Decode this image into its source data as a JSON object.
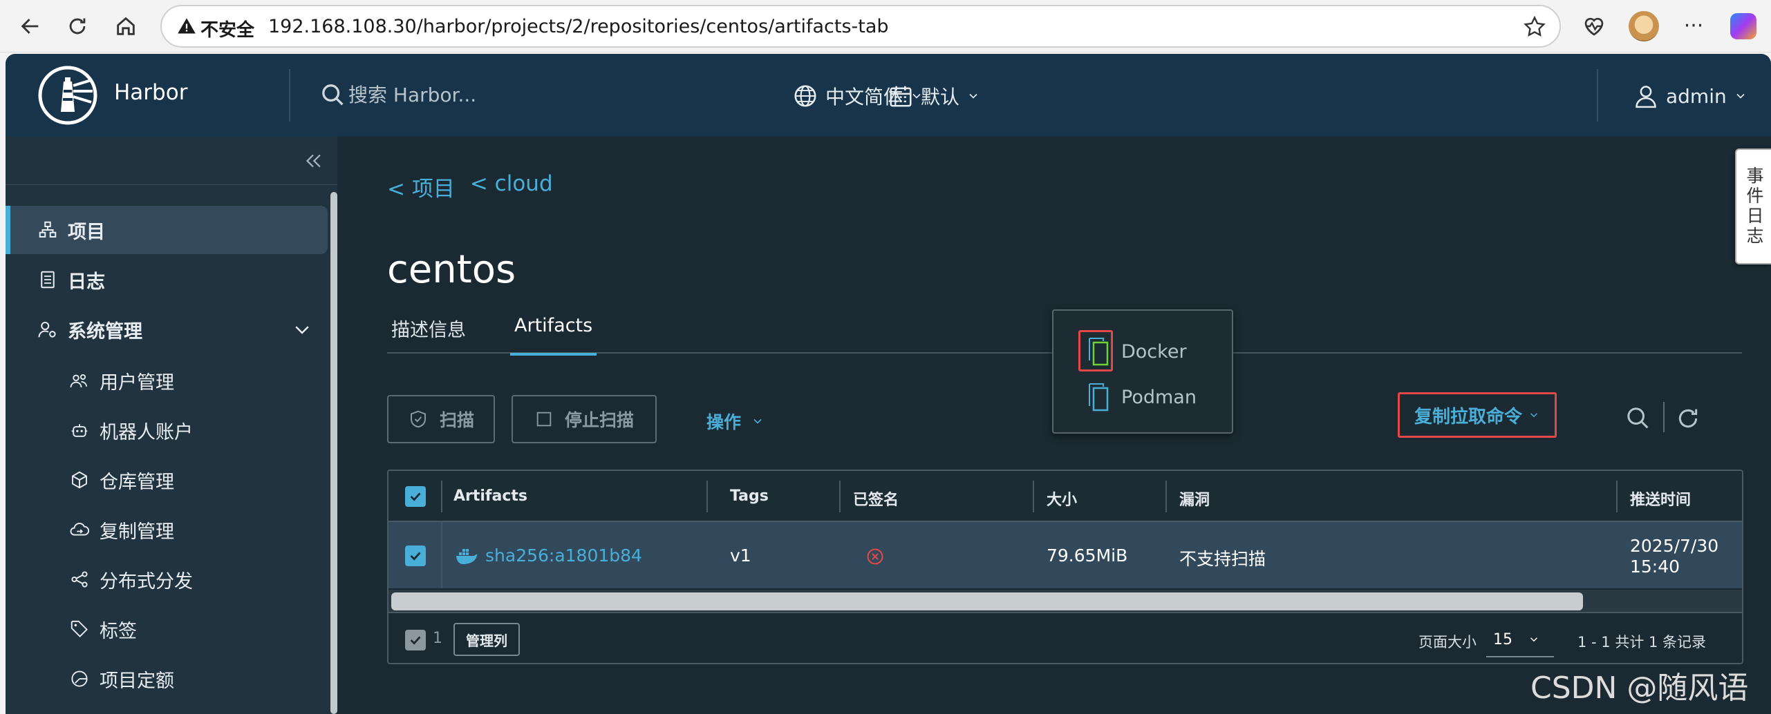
{
  "browser": {
    "insecure_label": "不安全",
    "url": "192.168.108.30/harbor/projects/2/repositories/centos/artifacts-tab"
  },
  "header": {
    "app_name": "Harbor",
    "search_placeholder": "搜索 Harbor...",
    "language": "中文简体",
    "date_format": "默认",
    "user": "admin"
  },
  "sidebar": {
    "items": [
      {
        "label": "项目",
        "icon": "projects-icon"
      },
      {
        "label": "日志",
        "icon": "log-icon"
      },
      {
        "label": "系统管理",
        "icon": "admin-icon"
      }
    ],
    "sub_items": [
      {
        "label": "用户管理",
        "icon": "users-icon"
      },
      {
        "label": "机器人账户",
        "icon": "robot-icon"
      },
      {
        "label": "仓库管理",
        "icon": "registry-icon"
      },
      {
        "label": "复制管理",
        "icon": "replication-icon"
      },
      {
        "label": "分布式分发",
        "icon": "distribution-icon"
      },
      {
        "label": "标签",
        "icon": "tag-icon"
      },
      {
        "label": "项目定额",
        "icon": "quota-icon"
      }
    ]
  },
  "breadcrumb": [
    "< 项目",
    "< cloud"
  ],
  "page_title": "centos",
  "tabs": [
    "描述信息",
    "Artifacts"
  ],
  "toolbar": {
    "scan": "扫描",
    "stop_scan": "停止扫描",
    "actions": "操作",
    "copy_pull_command": "复制拉取命令"
  },
  "pull_menu": [
    "Docker",
    "Podman"
  ],
  "table": {
    "columns": [
      "Artifacts",
      "Tags",
      "已签名",
      "大小",
      "漏洞",
      "推送时间"
    ],
    "rows": [
      {
        "artifact": "sha256:a1801b84",
        "tags": "v1",
        "size": "79.65MiB",
        "vulnerabilities": "不支持扫描",
        "push_time_date": "2025/7/30",
        "push_time_time": "15:40"
      }
    ],
    "selected_count": "1",
    "manage_columns": "管理列",
    "page_size_label": "页面大小",
    "page_size": "15",
    "pagination": "1 - 1 共计 1 条记录"
  },
  "event_log": "事件日志",
  "watermark": "CSDN @随风语",
  "colors": {
    "header_bg": "#17344a",
    "sidebar_bg": "#21333f",
    "main_bg": "#1b2a32",
    "accent": "#49afd9",
    "highlight_red": "#e34848"
  }
}
